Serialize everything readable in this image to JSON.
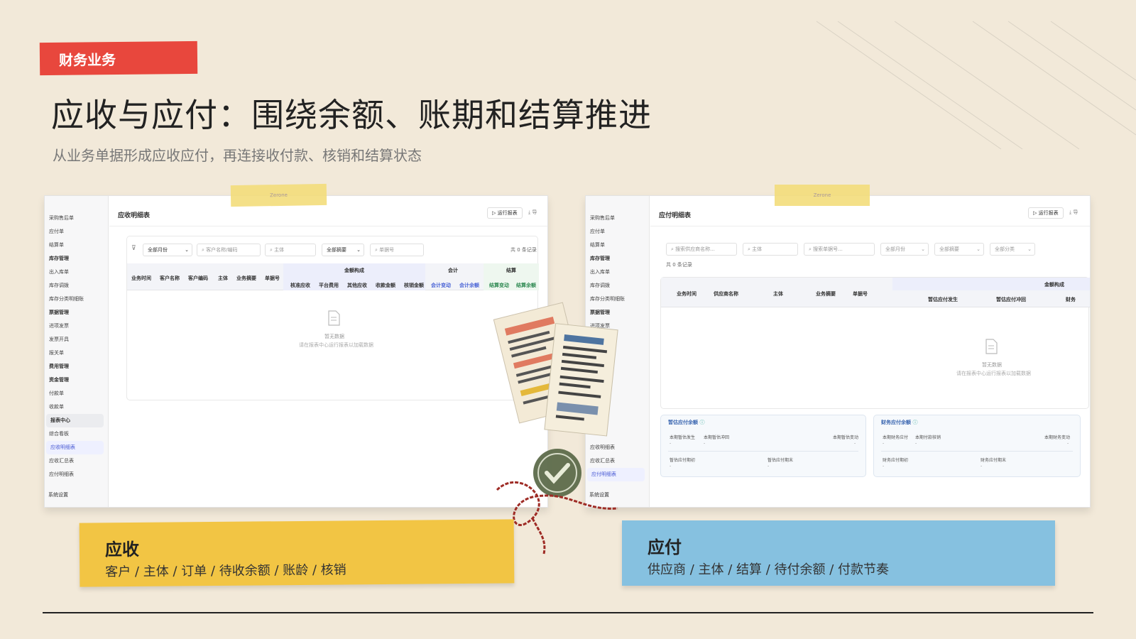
{
  "header": {
    "tag": "财务业务",
    "title": "应收与应付：围绕余额、账期和结算推进",
    "subtitle": "从业务单据形成应收应付，再连接收付款、核销和结算状态"
  },
  "tape_text": "Zerone",
  "left_screen": {
    "sidebar": {
      "items": [
        "采购售后单",
        "应付单",
        "结算单",
        "库存管理",
        "出入库单",
        "库存调拨",
        "库存分类明细账",
        "票据管理",
        "进项发票",
        "发票开具",
        "报关单",
        "费用管理",
        "资金管理",
        "付款单",
        "收款单",
        "报表中心",
        "综合看板",
        "应收明细表",
        "应收汇总表",
        "应付明细表"
      ],
      "footer": "系统设置"
    },
    "title": "应收明细表",
    "run_button": "运行报表",
    "download_button": "导",
    "filters": [
      "全部月份",
      "客户名称/编码",
      "主体",
      "全部摘要",
      "单据号"
    ],
    "record_count": "共 0 条记录",
    "columns": [
      "业务时间",
      "客户名称",
      "客户编码",
      "主体",
      "业务摘要",
      "单据号"
    ],
    "group_amount": "金额构成",
    "amount_columns": [
      "核准应收",
      "平台费用",
      "其他应收",
      "收款金额",
      "核销金额"
    ],
    "group_accounting": "会计",
    "accounting_columns": [
      "会计变动",
      "会计余额"
    ],
    "group_settlement": "结算",
    "settlement_columns": [
      "结算变动",
      "结算余额"
    ],
    "empty_title": "暂无数据",
    "empty_hint": "请在报表中心运行报表以加载数据"
  },
  "right_screen": {
    "sidebar": {
      "items": [
        "采购售后单",
        "应付单",
        "结算单",
        "库存管理",
        "出入库单",
        "库存调拨",
        "库存分类明细账",
        "票据管理",
        "进项发票",
        "应收明细表",
        "应收汇总表",
        "应付明细表"
      ],
      "footer": "系统设置"
    },
    "title": "应付明细表",
    "run_button": "运行报表",
    "download_button": "导",
    "filters": [
      "搜索供应商名称...",
      "主体",
      "搜索单据号...",
      "全部月份",
      "全部摘要",
      "全部分类"
    ],
    "record_count": "共 0 条记录",
    "columns": [
      "业务时间",
      "供应商名称",
      "主体",
      "业务摘要",
      "单据号"
    ],
    "group_amount": "金额构成",
    "amount_columns": [
      "暂估应付发生",
      "暂估应付冲回",
      "财务"
    ],
    "empty_title": "暂无数据",
    "empty_hint": "请在报表中心运行报表以加载数据",
    "summary_left": {
      "title": "暂估应付余额",
      "labels": [
        "本期暂估发生",
        "本期暂估冲回",
        "本期暂估变动",
        "暂估应付期初",
        "暂估应付期末"
      ],
      "value": "-"
    },
    "summary_right": {
      "title": "财务应付余额",
      "labels": [
        "本期财务应付",
        "本期付款核销",
        "本期财务变动",
        "财务应付期初",
        "财务应付期末"
      ],
      "value": "-"
    }
  },
  "notes": {
    "receivable": {
      "title": "应收",
      "items": "客户 / 主体 / 订单 / 待收余额 / 账龄 / 核销"
    },
    "payable": {
      "title": "应付",
      "items": "供应商 / 主体 / 结算 / 待付余额 / 付款节奏"
    }
  }
}
